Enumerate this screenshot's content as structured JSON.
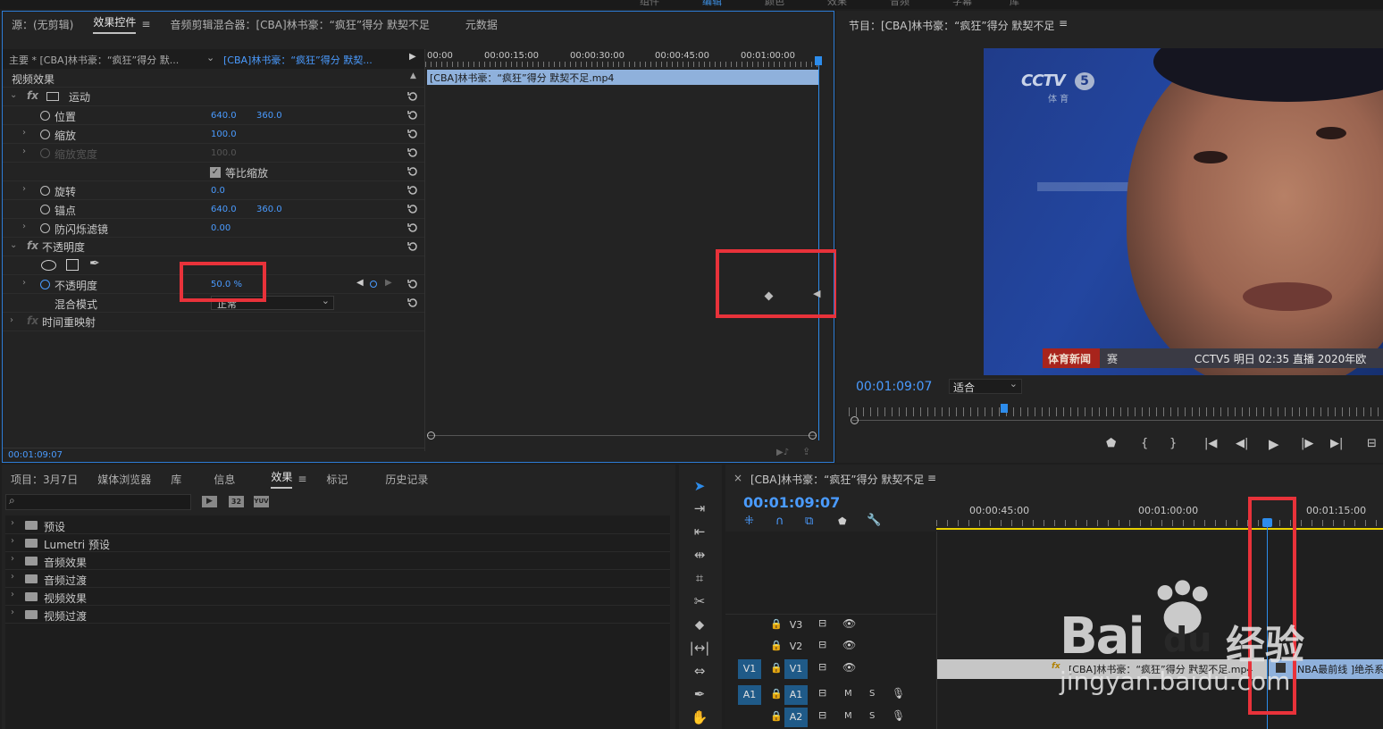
{
  "top_menu": [
    "组件",
    "编辑",
    "颜色",
    "效果",
    "音频",
    "字幕",
    "库"
  ],
  "effect_panel": {
    "tabs": [
      "源：(无剪辑)",
      "效果控件",
      "音频剪辑混合器：[CBA]林书豪：“疯狂”得分 默契不足",
      "元数据"
    ],
    "menu_glyph": "≡",
    "master_label": "主要 * [CBA]林书豪：“疯狂”得分 默...",
    "clip_selector": "[CBA]林书豪：“疯狂”得分 默契...",
    "section": "视频效果",
    "ruler": [
      "00:00",
      "00:00:15:00",
      "00:00:30:00",
      "00:00:45:00",
      "00:01:00:00"
    ],
    "clip_bar": "[CBA]林书豪：“疯狂”得分 默契不足.mp4",
    "motion": "运动",
    "position": {
      "label": "位置",
      "x": "640.0",
      "y": "360.0"
    },
    "scale": {
      "label": "缩放",
      "value": "100.0"
    },
    "scale_width": {
      "label": "缩放宽度",
      "value": "100.0"
    },
    "uniform_scale": "等比缩放",
    "rotation": {
      "label": "旋转",
      "value": "0.0"
    },
    "anchor": {
      "label": "锚点",
      "x": "640.0",
      "y": "360.0"
    },
    "antiflicker": {
      "label": "防闪烁滤镜",
      "value": "0.00"
    },
    "opacity_group": "不透明度",
    "opacity": {
      "label": "不透明度",
      "value": "50.0 %"
    },
    "blend": {
      "label": "混合模式",
      "value": "正常"
    },
    "time_remap": "时间重映射",
    "timecode": "00:01:09:07"
  },
  "program": {
    "title": "节目：[CBA]林书豪：“疯狂”得分 默契不足",
    "timecode": "00:01:09:07",
    "fit": "适合",
    "video": {
      "logo": "CCTV",
      "logo_num": "5",
      "logo_sub": "体 育",
      "news_tag": "体育新闻",
      "news_tag_tail": "赛",
      "ticker": "CCTV5 明日 02:35 直播 2020年欧"
    }
  },
  "project_panel": {
    "tabs": [
      "项目：3月7日",
      "媒体浏览器",
      "库",
      "信息",
      "效果",
      "标记",
      "历史记录"
    ],
    "active_tab": "效果",
    "menu_glyph": "≡",
    "search_placeholder": "",
    "badges": [
      "32",
      "YUV"
    ],
    "items": [
      "预设",
      "Lumetri 预设",
      "音频效果",
      "音频过渡",
      "视频效果",
      "视频过渡"
    ]
  },
  "timeline": {
    "close": "×",
    "title": "[CBA]林书豪：“疯狂”得分 默契不足",
    "menu_glyph": "≡",
    "timecode": "00:01:09:07",
    "ruler": [
      "00:00:45:00",
      "00:01:00:00",
      "00:01:15:00"
    ],
    "tracks": [
      {
        "name": "V3",
        "source": ""
      },
      {
        "name": "V2",
        "source": ""
      },
      {
        "name": "V1",
        "source": "V1"
      },
      {
        "name": "A1",
        "source": "A1"
      },
      {
        "name": "A2",
        "source": ""
      }
    ],
    "audio_btns": [
      "M",
      "S"
    ],
    "clip_fx": "fx",
    "clip1": "[CBA]林书豪：“疯狂”得分 默契不足.mp4",
    "clip2": "NBA最前线 ]绝杀系"
  },
  "watermark": {
    "brand": "Bai",
    "brand_du": "du",
    "brand_cn": "经验",
    "url": "jingyan.baidu.com"
  },
  "colors": {
    "accent": "#2d8ceb",
    "highlight": "#e8323a",
    "timecode": "#4a9bff",
    "work_area": "#e8d000"
  }
}
